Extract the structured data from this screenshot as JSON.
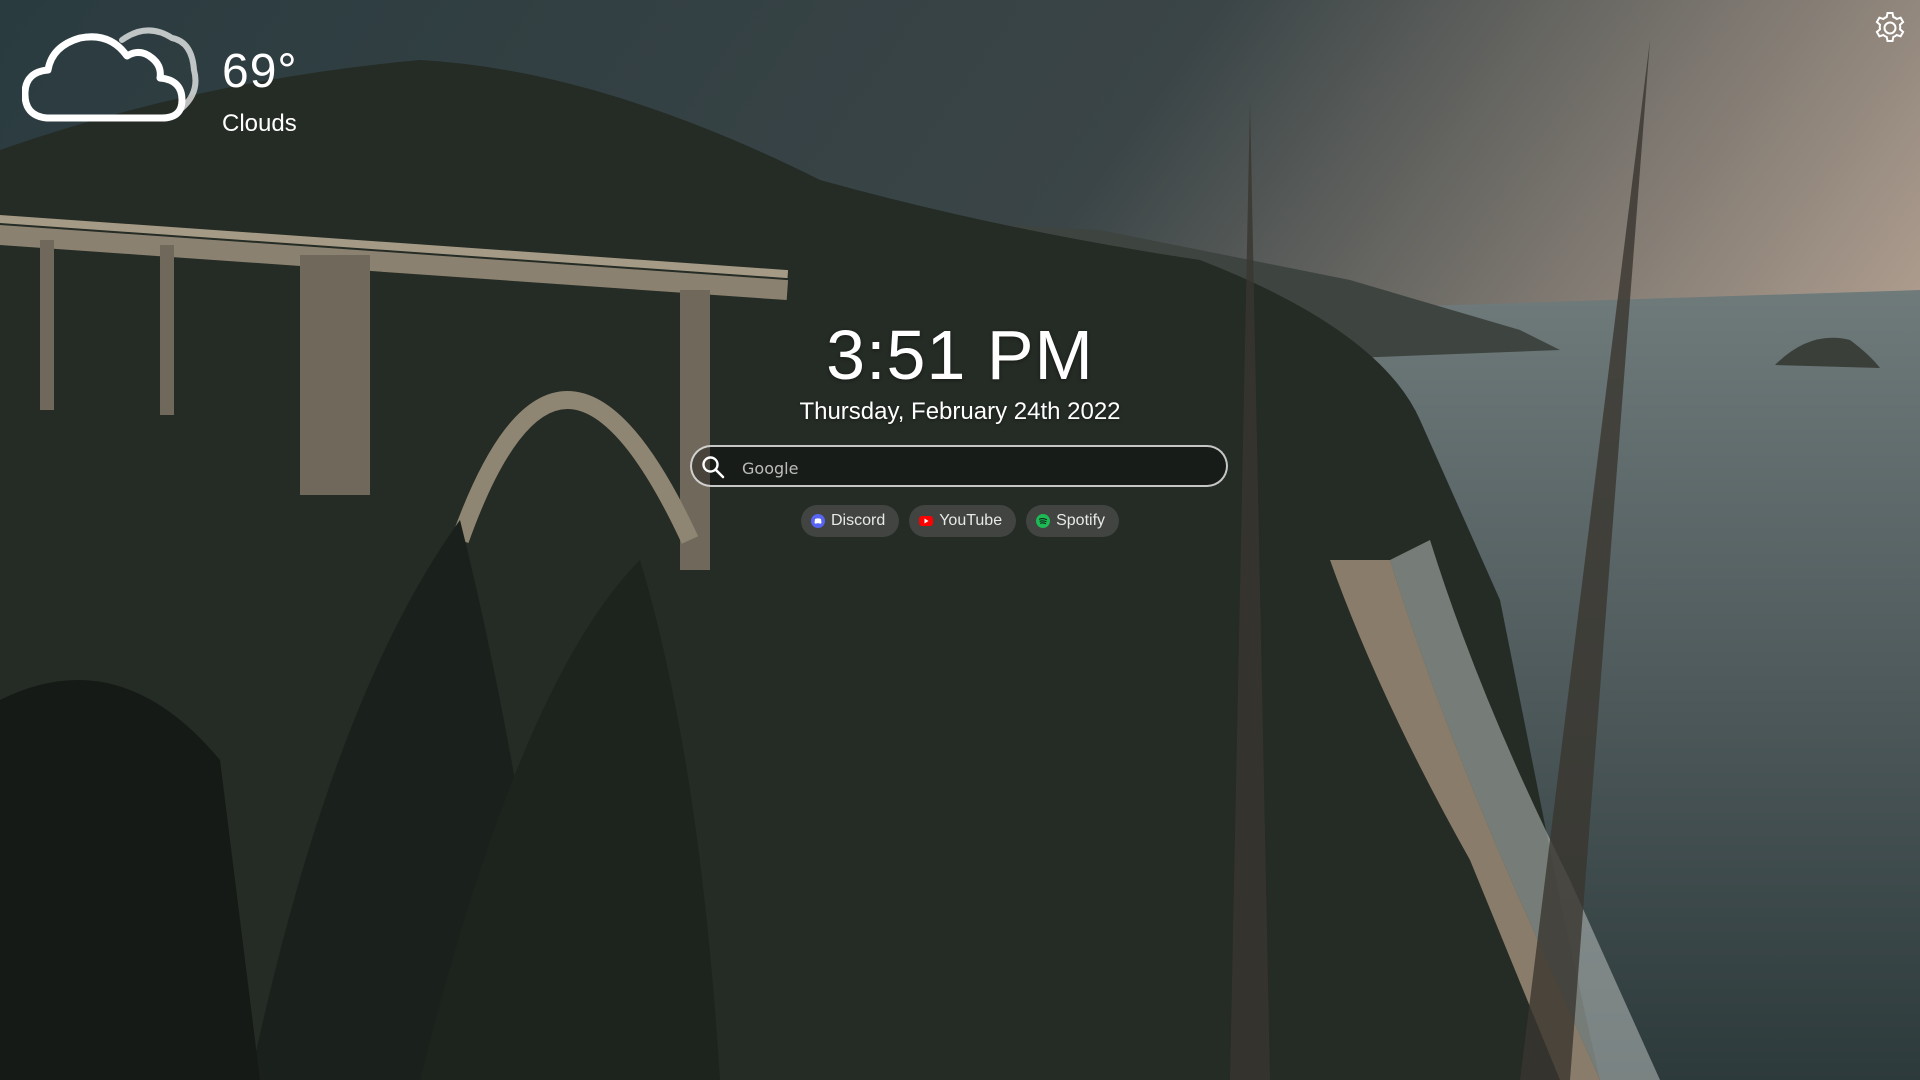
{
  "weather": {
    "temperature": "69°",
    "condition": "Clouds",
    "icon": "cloud-icon"
  },
  "clock": {
    "time": "3:51 PM",
    "date": "Thursday, February 24th 2022"
  },
  "search": {
    "placeholder": "Google",
    "value": "",
    "icon": "search-icon"
  },
  "shortcuts": [
    {
      "label": "Discord",
      "icon": "discord-icon",
      "color": "#5865F2"
    },
    {
      "label": "YouTube",
      "icon": "youtube-icon",
      "color": "#FF0000"
    },
    {
      "label": "Spotify",
      "icon": "spotify-icon",
      "color": "#1DB954"
    }
  ],
  "settings": {
    "icon": "gear-icon"
  }
}
